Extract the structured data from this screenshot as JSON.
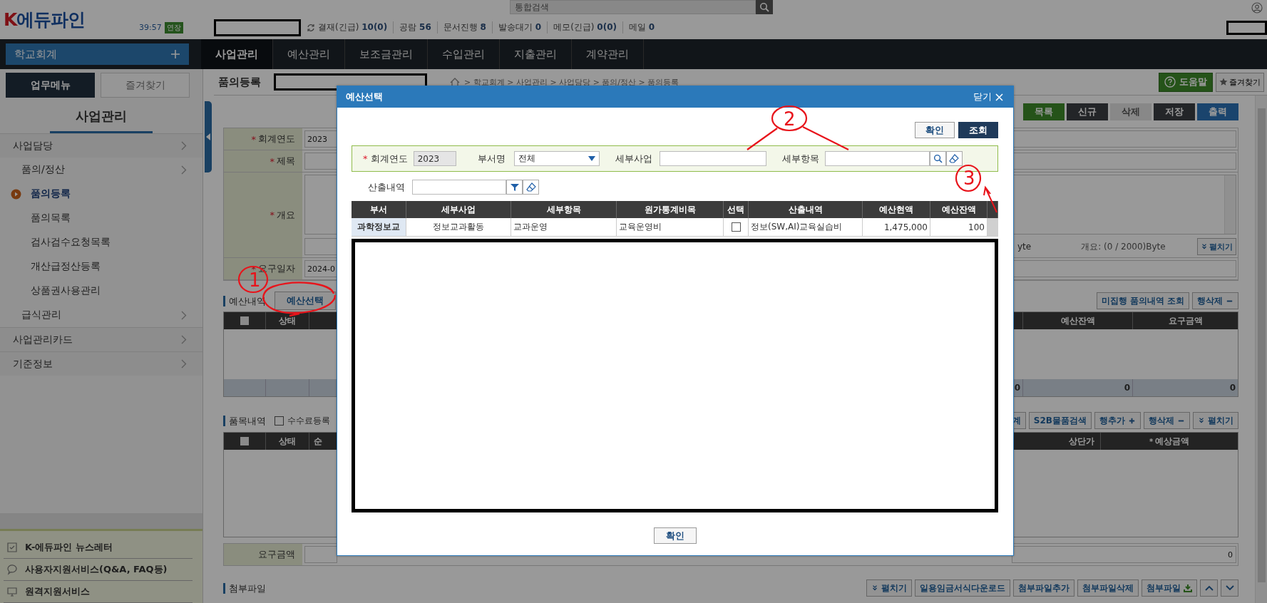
{
  "header": {
    "logo": {
      "prefix": "K",
      "name": "에듀파인"
    },
    "timer": "39:57",
    "extend_button": "연장",
    "search": {
      "placeholder": "통합검색"
    },
    "status": [
      {
        "label": "결재(긴급)",
        "value": "10(0)"
      },
      {
        "label": "공람",
        "value": "56"
      },
      {
        "label": "문서진행",
        "value": "8"
      },
      {
        "label": "발송대기",
        "value": "0"
      },
      {
        "label": "메모(긴급)",
        "value": "0(0)"
      },
      {
        "label": "메일",
        "value": "0"
      }
    ]
  },
  "nav": {
    "module": "학교회계",
    "tabs": [
      {
        "label": "사업관리",
        "selected": true
      },
      {
        "label": "예산관리",
        "selected": false
      },
      {
        "label": "보조금관리",
        "selected": false
      },
      {
        "label": "수입관리",
        "selected": false
      },
      {
        "label": "지출관리",
        "selected": false
      },
      {
        "label": "계약관리",
        "selected": false
      }
    ]
  },
  "sidebar": {
    "tabs": [
      {
        "label": "업무메뉴",
        "selected": true
      },
      {
        "label": "즐겨찾기",
        "selected": false
      }
    ],
    "title": "사업관리",
    "menu": [
      {
        "label": "사업담당",
        "kind": "folder",
        "selected": false,
        "children": [
          {
            "label": "품의/정산",
            "kind": "folder",
            "selected": false,
            "children": [
              {
                "label": "품의등록",
                "kind": "page",
                "selected": true
              },
              {
                "label": "품의목록",
                "kind": "page",
                "selected": false
              },
              {
                "label": "검사검수요청목록",
                "kind": "page",
                "selected": false
              },
              {
                "label": "개산급정산등록",
                "kind": "page",
                "selected": false
              },
              {
                "label": "상품권사용관리",
                "kind": "page",
                "selected": false
              }
            ]
          },
          {
            "label": "급식관리",
            "kind": "folder",
            "selected": false
          }
        ]
      },
      {
        "label": "사업관리카드",
        "kind": "folder",
        "selected": false
      },
      {
        "label": "기준정보",
        "kind": "folder",
        "selected": false
      }
    ],
    "links": [
      {
        "label": "K-에듀파인 뉴스레터",
        "kind": "newsletter"
      },
      {
        "label": "사용자지원서비스(Q&A, FAQ등)",
        "kind": "support"
      },
      {
        "label": "원격지원서비스",
        "kind": "remote"
      }
    ]
  },
  "page": {
    "title": "품의등록",
    "breadcrumb": "> 학교회계 > 사업관리 > 사업담당 > 품의/정산 > 품의등록",
    "help_button": "도움말",
    "favorite_button": "즐겨찾기",
    "actions": [
      {
        "label": "목록",
        "kind": "accent",
        "disabled": false
      },
      {
        "label": "신규",
        "kind": "dark",
        "disabled": false
      },
      {
        "label": "삭제",
        "kind": "dark",
        "disabled": true
      },
      {
        "label": "저장",
        "kind": "dark",
        "disabled": false
      },
      {
        "label": "출력",
        "kind": "info",
        "disabled": false
      }
    ]
  },
  "form": {
    "fields": [
      {
        "mark": "*",
        "label": "회계연도",
        "kind": "input",
        "value": "2023"
      },
      {
        "mark": "*",
        "label": "제목",
        "kind": "input"
      },
      {
        "mark": "*",
        "label": "개요",
        "kind": "textarea"
      },
      {
        "mark": "*",
        "label": "요구일자",
        "kind": "input",
        "value": "2024-0"
      }
    ],
    "byte_cut": "yte",
    "byte_count": "개요: (0 / 2000)Byte",
    "expand_button": "펼치기"
  },
  "budget": {
    "title": "예산내역",
    "select_button": "예산선택",
    "buttons": [
      {
        "label": "미집행 품의내역 조회",
        "kind": "text"
      },
      {
        "label": "행삭제",
        "kind": "remove"
      }
    ],
    "header_checked": false,
    "columns_left": [
      {
        "label": "상태"
      }
    ],
    "columns_right": [
      {
        "label": "예산잔액"
      },
      {
        "label": "요구금액"
      }
    ],
    "totals": [
      "0",
      "0",
      "0"
    ]
  },
  "items": {
    "title": "품목내역",
    "fee_checkbox": {
      "label": "수수료등록",
      "checked": false
    },
    "buttons": [
      {
        "label": "계",
        "kind": "text"
      },
      {
        "label": "S2B물품검색",
        "kind": "text"
      },
      {
        "label": "행추가",
        "kind": "add"
      },
      {
        "label": "행삭제",
        "kind": "remove"
      },
      {
        "label": "펼치기",
        "kind": "expand"
      }
    ],
    "header_checked": false,
    "columns_left": [
      {
        "label": "상태"
      },
      {
        "label": "순"
      }
    ],
    "columns_right": [
      {
        "label": "상단가"
      },
      {
        "mark": "*",
        "label": "예상금액"
      }
    ]
  },
  "amount": {
    "label": "요구금액",
    "value": "0"
  },
  "attachments": {
    "title": "첨부파일",
    "buttons": [
      {
        "label": "펼치기",
        "kind": "expand"
      },
      {
        "label": "일용임금서식다운로드",
        "kind": "text"
      },
      {
        "label": "첨부파일추가",
        "kind": "text"
      },
      {
        "label": "첨부파일삭제",
        "kind": "text"
      },
      {
        "label": "첨부파일",
        "kind": "download"
      }
    ]
  },
  "modal": {
    "title": "예산선택",
    "close": "닫기",
    "top_buttons": [
      {
        "label": "확인",
        "kind": "light"
      },
      {
        "label": "조회",
        "kind": "dark"
      }
    ],
    "filters": {
      "year": {
        "mark": "*",
        "label": "회계연도",
        "value": "2023"
      },
      "dept": {
        "label": "부서명",
        "value": "전체"
      },
      "project": {
        "label": "세부사업"
      },
      "item": {
        "label": "세부항목"
      },
      "calc": {
        "label": "산출내역"
      }
    },
    "table": {
      "columns": [
        "부서",
        "세부사업",
        "세부항목",
        "원가통계비목",
        "선택",
        "산출내역",
        "예산현액",
        "예산잔액"
      ],
      "rows": [
        {
          "dept": "과학정보교",
          "project": "정보교과활동",
          "item": "교과운영",
          "cost_item": "교육운영비",
          "checked": false,
          "calc": "정보(SW,AI)교육실습비",
          "budget": "1,475,000",
          "balance": "100"
        }
      ]
    },
    "ok_button": "확인"
  },
  "annotations": [
    {
      "label": "1"
    },
    {
      "label": "2"
    },
    {
      "label": "3"
    }
  ]
}
